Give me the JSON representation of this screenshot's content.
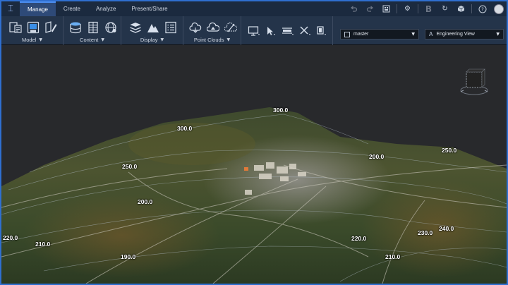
{
  "menu": {
    "tabs": [
      {
        "label": "Manage",
        "active": true
      },
      {
        "label": "Create",
        "active": false
      },
      {
        "label": "Analyze",
        "active": false
      },
      {
        "label": "Present/Share",
        "active": false
      }
    ]
  },
  "toolbar_right": {
    "icons": [
      "undo-icon",
      "redo-icon",
      "layout-icon",
      "settings-icon",
      "bold-b-icon",
      "sync-icon",
      "cube-icon",
      "help-icon",
      "user-avatar"
    ]
  },
  "ribbon": {
    "groups": [
      {
        "label": "Model",
        "icons": [
          "model-import-icon",
          "model-save-icon",
          "model-edit-icon"
        ]
      },
      {
        "label": "Content",
        "icons": [
          "database-icon",
          "data-table-icon",
          "globe-icon"
        ]
      },
      {
        "label": "Display",
        "icons": [
          "layers-icon",
          "terrain-icon",
          "list-icon"
        ]
      },
      {
        "label": "Point Clouds",
        "icons": [
          "cloud-icon",
          "point-cloud-icon",
          "cloud-settings-icon"
        ]
      }
    ],
    "tools": [
      "screen-icon",
      "select-arrow-icon",
      "measure-icon",
      "crossing-icon",
      "clip-icon"
    ],
    "branch_select": {
      "value": "master"
    },
    "view_select": {
      "value": "Engineering View"
    }
  },
  "viewport": {
    "contour_labels": [
      "300.0",
      "300.0",
      "250.0",
      "200.0",
      "250.0",
      "200.0",
      "240.0",
      "230.0",
      "220.0",
      "220.0",
      "210.0",
      "210.0",
      "190.0"
    ]
  }
}
